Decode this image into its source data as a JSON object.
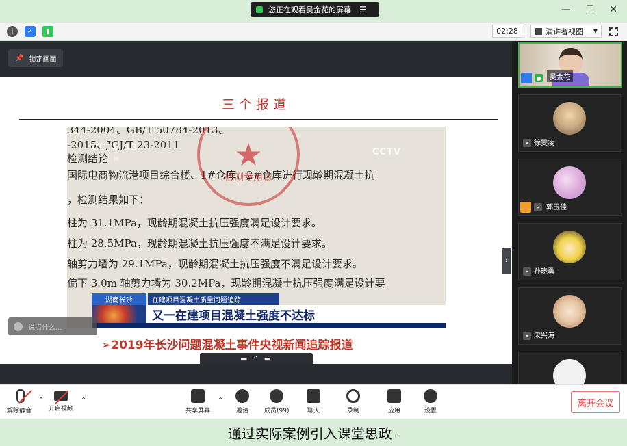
{
  "share_banner": {
    "text": "您正在观看吴金花的屏幕",
    "menu_glyph": "☰"
  },
  "window_controls": {
    "minimize": "—",
    "maximize": "☐",
    "close": "✕"
  },
  "topbar": {
    "timer": "02:28",
    "view_mode": "演讲者视图",
    "colors": {
      "info": "#555555",
      "shield": "#2d7df0",
      "signal": "#35c759"
    }
  },
  "stage": {
    "lock_label": "锁定画面",
    "slide": {
      "title": "三个报道",
      "document_lines": [
        "344-2004、GB/T 50784-2013、",
        "-2015、JGJ/T 23-2011",
        "             检测结论",
        "国际电商物流港项目综合楼、1#仓库、2#仓库进行现龄期混凝土抗",
        "，检测结果如下：",
        "柱为 31.1MPa，现龄期混凝土抗压强度满足设计要求。",
        "柱为 28.5MPa，现龄期混凝土抗压强度不满足设计要求。",
        "轴剪力墙为 29.1MPa，现龄期混凝土抗压强度不满足设计要求。",
        "偏下 3.0m 轴剪力墙为 30.2MPa，现龄期混凝土抗压强度满足设计要"
      ],
      "stamp_text": "检测专用章",
      "watermark_logo": "CCTV 13",
      "watermark_sub": "新闻",
      "watermark_logo_right": "CCTV",
      "news": {
        "location": "湖南长沙",
        "topic": "在建项目混凝土质量问题追踪",
        "headline": "又一在建项目混凝土强度不达标"
      },
      "caption": "➢2019年长沙问题混凝土事件央视新闻追踪报道"
    },
    "chat_placeholder": "说点什么...",
    "collapse_glyph": "▬ ⌃ ▬",
    "side_toggle_glyph": "›"
  },
  "participants": [
    {
      "name": "吴金花",
      "active": true
    },
    {
      "name": "徐雯凌",
      "avatar_color": "#c8a982"
    },
    {
      "name": "郭玉佳",
      "avatar_color": "#d9a8d8"
    },
    {
      "name": "孙晓勇",
      "avatar_color": "#f2d34a"
    },
    {
      "name": "宋兴海",
      "avatar_color": "#e5c7a7"
    }
  ],
  "bottombar": {
    "unmute": "解除静音",
    "start_video": "开启视频",
    "share_screen": "共享屏幕",
    "invite": "邀请",
    "members": "成员(99)",
    "chat": "聊天",
    "record": "录制",
    "apps": "应用",
    "settings": "设置",
    "leave": "离开会议",
    "caret": "⌃"
  },
  "doc_caption": {
    "text": "通过实际案例引入课堂思政",
    "mark": "↵"
  }
}
